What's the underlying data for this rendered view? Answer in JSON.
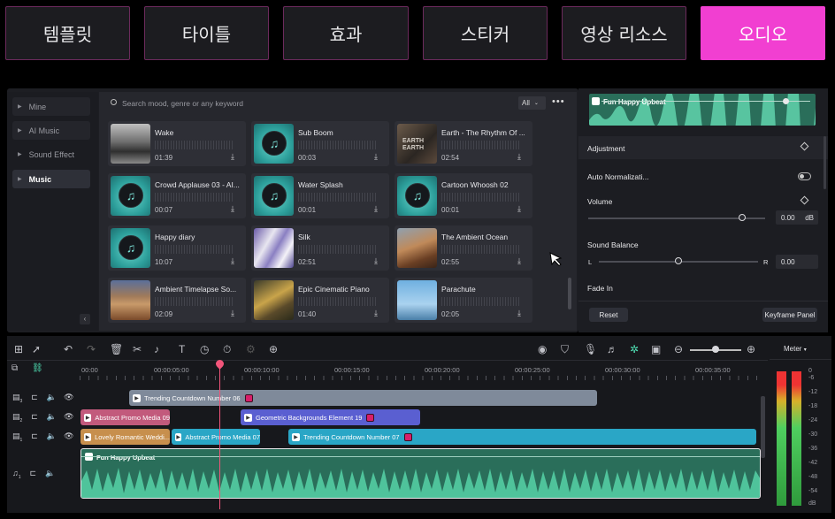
{
  "top_tabs": [
    {
      "label": "템플릿",
      "active": false
    },
    {
      "label": "타이틀",
      "active": false
    },
    {
      "label": "효과",
      "active": false
    },
    {
      "label": "스티커",
      "active": false
    },
    {
      "label": "영상 리소스",
      "active": false
    },
    {
      "label": "오디오",
      "active": true
    }
  ],
  "sidebar": {
    "items": [
      {
        "label": "Mine",
        "selected": false
      },
      {
        "label": "AI Music",
        "selected": false
      },
      {
        "label": "Sound Effect",
        "selected": false
      },
      {
        "label": "Music",
        "selected": true
      }
    ]
  },
  "search": {
    "placeholder": "Search mood, genre or any keyword",
    "filter": "All"
  },
  "tracks": [
    {
      "name": "Wake",
      "duration": "01:39",
      "thumb": "photo-bw"
    },
    {
      "name": "Sub Boom",
      "duration": "00:03",
      "thumb": "music"
    },
    {
      "name": "Earth - The Rhythm Of ...",
      "duration": "02:54",
      "thumb": "earth",
      "thumb_text": "EARTH EARTH"
    },
    {
      "name": "Crowd Applause 03 - AI...",
      "duration": "00:07",
      "thumb": "music"
    },
    {
      "name": "Water Splash",
      "duration": "00:01",
      "thumb": "music"
    },
    {
      "name": "Cartoon Whoosh 02",
      "duration": "00:01",
      "thumb": "music"
    },
    {
      "name": "Happy diary",
      "duration": "10:07",
      "thumb": "music"
    },
    {
      "name": "Silk",
      "duration": "02:51",
      "thumb": "silk"
    },
    {
      "name": "The Ambient Ocean",
      "duration": "02:55",
      "thumb": "rock"
    },
    {
      "name": "Ambient Timelapse So...",
      "duration": "02:09",
      "thumb": "desert"
    },
    {
      "name": "Epic Cinematic Piano",
      "duration": "01:40",
      "thumb": "road"
    },
    {
      "name": "Parachute",
      "duration": "02:05",
      "thumb": "sky"
    }
  ],
  "properties": {
    "clip_title": "Fun Happy Upbeat",
    "adjustment": "Adjustment",
    "auto_normalization": "Auto Normalizati...",
    "volume_label": "Volume",
    "volume_value": "0.00",
    "volume_unit": "dB",
    "volume_level": 0.87,
    "sound_balance_label": "Sound Balance",
    "balance_left": "L",
    "balance_right": "R",
    "balance_value": "0.00",
    "balance_level": 0.5,
    "fade_in": "Fade In",
    "reset": "Reset",
    "keyframe_panel": "Keyframe Panel"
  },
  "timeline": {
    "ruler": [
      "00:00",
      "00:00:05:00",
      "00:00:10:00",
      "00:00:15:00",
      "00:00:20:00",
      "00:00:25:00",
      "00:00:30:00",
      "00:00:35:00"
    ],
    "track_labels": [
      "3",
      "2",
      "1",
      "1"
    ],
    "clips": [
      {
        "label": "Trending Countdown Number 06",
        "color": "#7f8a9a",
        "pro": true
      },
      {
        "label": "Abstract Promo Media 09",
        "color": "#c25a7c",
        "pro": false
      },
      {
        "label": "Geometric Backgrounds Element 19",
        "color": "#5a5fd1",
        "pro": true
      },
      {
        "label": "Lovely Romantic Weddi...",
        "color": "#c78f4d",
        "pro": false
      },
      {
        "label": "Abstract Promo Media 07",
        "color": "#2aa6c6",
        "pro": false
      },
      {
        "label": "Trending Countdown Number 07",
        "color": "#2aa6c6",
        "pro": true
      }
    ],
    "audio_clip": "Fun Happy Upbeat"
  },
  "meter": {
    "title": "Meter",
    "scale": [
      "0",
      "-6",
      "-12",
      "-18",
      "-24",
      "-30",
      "-36",
      "-42",
      "-48",
      "-54",
      "dB"
    ]
  }
}
